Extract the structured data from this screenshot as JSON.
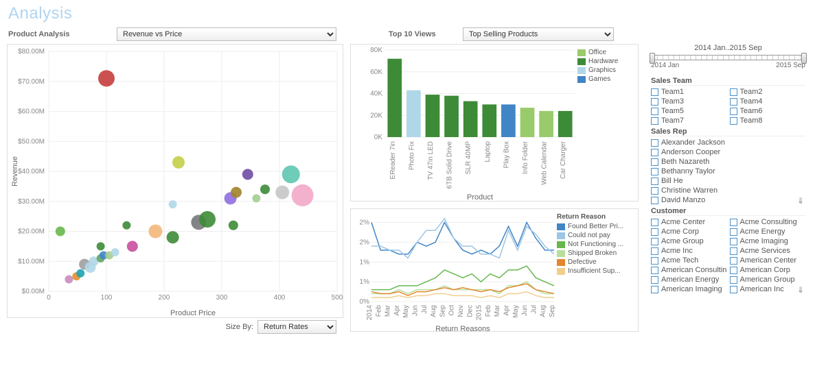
{
  "title": "Analysis",
  "row1": {
    "product_analysis_label": "Product Analysis",
    "product_analysis_select": "Revenue vs Price",
    "top10_label": "Top 10 Views",
    "top10_select": "Top Selling Products"
  },
  "size_by_label": "Size By:",
  "size_by_select": "Return Rates",
  "time_slider": {
    "caption": "2014 Jan..2015 Sep",
    "left": "2014 Jan",
    "right": "2015 Sep"
  },
  "filters": {
    "sales_team": {
      "title": "Sales Team",
      "items": [
        "Team1",
        "Team2",
        "Team3",
        "Team4",
        "Team5",
        "Team6",
        "Team7",
        "Team8"
      ]
    },
    "sales_rep": {
      "title": "Sales Rep",
      "items": [
        "Alexander Jackson",
        "Anderson Cooper",
        "Beth Nazareth",
        "Bethanny Taylor",
        "Bill He",
        "Christine Warren",
        "David Manzo"
      ]
    },
    "customer": {
      "title": "Customer",
      "items": [
        "Acme Center",
        "Acme Consulting",
        "Acme Corp",
        "Acme Energy",
        "Acme Group",
        "Acme Imaging",
        "Acme Inc",
        "Acme Services",
        "Acme Tech",
        "American Center",
        "American Consulting",
        "American Corp",
        "American Energy",
        "American Group",
        "American Imaging",
        "American Inc"
      ]
    }
  },
  "chart_data": [
    {
      "type": "scatter",
      "title": "Revenue vs Price",
      "xlabel": "Product Price",
      "ylabel": "Revenue",
      "xlim": [
        0,
        500
      ],
      "ylim": [
        0,
        80000000
      ],
      "y_tick_format": "$#0.00M",
      "x_ticks": [
        0,
        100,
        200,
        300,
        400,
        500
      ],
      "y_ticks": [
        0,
        10,
        20,
        30,
        40,
        50,
        60,
        70,
        80
      ],
      "points": [
        {
          "x": 20,
          "y": 20,
          "r": 7,
          "color": "#67b74d"
        },
        {
          "x": 35,
          "y": 4,
          "r": 6,
          "color": "#c78dbd"
        },
        {
          "x": 48,
          "y": 5,
          "r": 6,
          "color": "#e28e2b"
        },
        {
          "x": 55,
          "y": 6,
          "r": 6,
          "color": "#1aa3b6"
        },
        {
          "x": 62,
          "y": 9,
          "r": 8,
          "color": "#9e9e9e"
        },
        {
          "x": 72,
          "y": 8,
          "r": 8,
          "color": "#b0d7e8"
        },
        {
          "x": 78,
          "y": 10,
          "r": 7,
          "color": "#b0d7e8"
        },
        {
          "x": 90,
          "y": 11,
          "r": 6,
          "color": "#66a560"
        },
        {
          "x": 90,
          "y": 15,
          "r": 6,
          "color": "#3d8b37"
        },
        {
          "x": 95,
          "y": 12,
          "r": 6,
          "color": "#4285c6"
        },
        {
          "x": 105,
          "y": 12,
          "r": 6,
          "color": "#a4cd92"
        },
        {
          "x": 100,
          "y": 71,
          "r": 12,
          "color": "#c53d3d"
        },
        {
          "x": 115,
          "y": 13,
          "r": 6,
          "color": "#b0d7e8"
        },
        {
          "x": 145,
          "y": 15,
          "r": 8,
          "color": "#c94fa1"
        },
        {
          "x": 135,
          "y": 22,
          "r": 6,
          "color": "#3d8b37"
        },
        {
          "x": 185,
          "y": 20,
          "r": 10,
          "color": "#f4b77a"
        },
        {
          "x": 215,
          "y": 18,
          "r": 9,
          "color": "#3d8b37"
        },
        {
          "x": 215,
          "y": 29,
          "r": 6,
          "color": "#b0d7e8"
        },
        {
          "x": 225,
          "y": 43,
          "r": 9,
          "color": "#c3cf48"
        },
        {
          "x": 255,
          "y": 23,
          "r": 7,
          "color": "#b0d7e8"
        },
        {
          "x": 260,
          "y": 23,
          "r": 11,
          "color": "#7a7a7a"
        },
        {
          "x": 275,
          "y": 24,
          "r": 12,
          "color": "#3d8b37"
        },
        {
          "x": 315,
          "y": 31,
          "r": 9,
          "color": "#8f6fe0"
        },
        {
          "x": 320,
          "y": 22,
          "r": 7,
          "color": "#3d8b37"
        },
        {
          "x": 325,
          "y": 33,
          "r": 8,
          "color": "#a08329"
        },
        {
          "x": 345,
          "y": 39,
          "r": 8,
          "color": "#714da4"
        },
        {
          "x": 360,
          "y": 31,
          "r": 6,
          "color": "#a4cd92"
        },
        {
          "x": 375,
          "y": 34,
          "r": 7,
          "color": "#3d8b37"
        },
        {
          "x": 405,
          "y": 33,
          "r": 10,
          "color": "#c6c6c6"
        },
        {
          "x": 420,
          "y": 39,
          "r": 13,
          "color": "#5ec6b0"
        },
        {
          "x": 440,
          "y": 32,
          "r": 16,
          "color": "#f3a8c9"
        }
      ]
    },
    {
      "type": "bar",
      "xlabel": "Product",
      "categories": [
        "EReader 7in",
        "Photo Fix",
        "TV 47in LED",
        "6TB Solid Drive",
        "SLR 40MP",
        "Laptop",
        "Play Box",
        "Info Folder",
        "Web Calendar",
        "Car Charger"
      ],
      "values": [
        72000,
        43000,
        39000,
        38000,
        33000,
        30000,
        30000,
        27000,
        24000,
        24000
      ],
      "series_cat": [
        "Hardware",
        "Graphics",
        "Hardware",
        "Hardware",
        "Hardware",
        "Hardware",
        "Games",
        "Office",
        "Office",
        "Hardware"
      ],
      "legend": [
        {
          "name": "Office",
          "color": "#9acb6b"
        },
        {
          "name": "Hardware",
          "color": "#3d8b37"
        },
        {
          "name": "Graphics",
          "color": "#b0d7e8"
        },
        {
          "name": "Games",
          "color": "#4285c6"
        }
      ],
      "ylim": [
        0,
        80000
      ],
      "y_ticks": [
        0,
        20000,
        40000,
        60000,
        80000
      ],
      "y_format": "#,###K"
    },
    {
      "type": "line",
      "title": "Return Reasons",
      "xlabel": "Return Reasons",
      "legend_title": "Return Reason",
      "x": [
        "2014",
        "Feb",
        "Mar",
        "Apr",
        "May",
        "Jun",
        "Jul",
        "Aug",
        "Sep",
        "Oct",
        "Nov",
        "Dec",
        "2015",
        "Feb",
        "Mar",
        "Apr",
        "May",
        "Jun",
        "Jul",
        "Aug",
        "Sep"
      ],
      "ylim": [
        0,
        2.2
      ],
      "y_ticks": [
        0,
        "0%",
        0.5,
        "0%",
        1,
        "1%",
        1.5,
        "2%",
        2,
        "2%"
      ],
      "series": [
        {
          "name": "Found Better Pri...",
          "color": "#4285c6",
          "values": [
            2.0,
            1.3,
            1.3,
            1.2,
            1.2,
            1.5,
            1.4,
            1.5,
            2.0,
            1.6,
            1.3,
            1.2,
            1.3,
            1.2,
            1.4,
            1.9,
            1.4,
            2.0,
            1.6,
            1.3,
            1.3
          ]
        },
        {
          "name": "Could not pay",
          "color": "#9cc5e6",
          "values": [
            1.4,
            1.4,
            1.3,
            1.3,
            1.1,
            1.5,
            1.8,
            1.8,
            2.1,
            1.6,
            1.4,
            1.4,
            1.2,
            1.2,
            1.1,
            1.8,
            1.3,
            1.9,
            1.7,
            1.4,
            1.2
          ]
        },
        {
          "name": "Not Functioning ...",
          "color": "#67b74d",
          "values": [
            0.3,
            0.3,
            0.3,
            0.4,
            0.4,
            0.4,
            0.5,
            0.6,
            0.8,
            0.7,
            0.6,
            0.7,
            0.5,
            0.7,
            0.6,
            0.8,
            0.8,
            0.9,
            0.6,
            0.5,
            0.4
          ]
        },
        {
          "name": "Shipped Broken",
          "color": "#b8de9b",
          "values": [
            0.2,
            0.2,
            0.2,
            0.3,
            0.2,
            0.3,
            0.3,
            0.3,
            0.4,
            0.3,
            0.3,
            0.3,
            0.3,
            0.3,
            0.2,
            0.4,
            0.4,
            0.5,
            0.3,
            0.2,
            0.2
          ]
        },
        {
          "name": "Defective",
          "color": "#e2872e",
          "values": [
            0.25,
            0.2,
            0.2,
            0.25,
            0.15,
            0.25,
            0.25,
            0.3,
            0.35,
            0.3,
            0.35,
            0.3,
            0.25,
            0.3,
            0.25,
            0.35,
            0.4,
            0.45,
            0.3,
            0.25,
            0.2
          ]
        },
        {
          "name": "Insufficient Sup...",
          "color": "#f2ce8e",
          "values": [
            0.1,
            0.1,
            0.1,
            0.15,
            0.1,
            0.15,
            0.15,
            0.2,
            0.2,
            0.15,
            0.15,
            0.15,
            0.1,
            0.15,
            0.1,
            0.2,
            0.2,
            0.25,
            0.15,
            0.1,
            0.1
          ]
        }
      ]
    }
  ]
}
